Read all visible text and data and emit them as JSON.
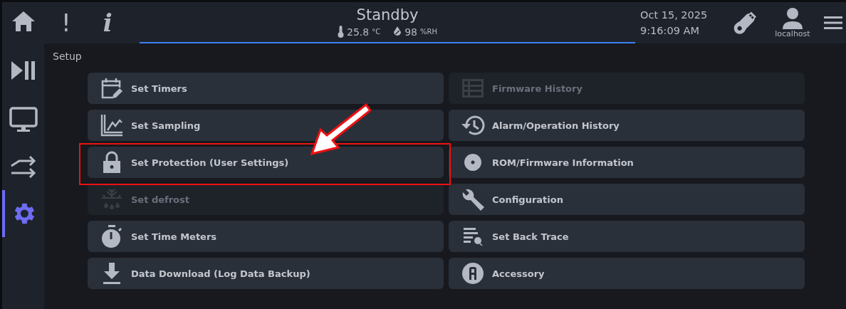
{
  "header": {
    "status": "Standby",
    "temperature": "25.8",
    "temperature_unit": "°C",
    "humidity": "98",
    "humidity_unit": "%RH",
    "date": "Oct 15, 2025",
    "time": "9:16:09 AM",
    "user": "localhost",
    "alert_label": "!",
    "info_label": "i"
  },
  "sidebar": {
    "items": [
      {
        "kind": "run",
        "selected": false
      },
      {
        "kind": "monitor",
        "selected": false
      },
      {
        "kind": "transfer",
        "selected": false
      },
      {
        "kind": "setup",
        "selected": true
      }
    ]
  },
  "page_title": "Setup",
  "menu": {
    "columns": [
      [
        {
          "label": "Set Timers",
          "disabled": false,
          "highlighted": false
        },
        {
          "label": "Set Sampling",
          "disabled": false,
          "highlighted": false
        },
        {
          "label": "Set Protection (User Settings)",
          "disabled": false,
          "highlighted": true
        },
        {
          "label": "Set defrost",
          "disabled": true,
          "highlighted": false
        },
        {
          "label": "Set Time Meters",
          "disabled": false,
          "highlighted": false
        },
        {
          "label": "Data Download (Log Data Backup)",
          "disabled": false,
          "highlighted": false
        }
      ],
      [
        {
          "label": "Firmware History",
          "disabled": true,
          "highlighted": false
        },
        {
          "label": "Alarm/Operation History",
          "disabled": false,
          "highlighted": false
        },
        {
          "label": "ROM/Firmware Information",
          "disabled": false,
          "highlighted": false
        },
        {
          "label": "Configuration",
          "disabled": false,
          "highlighted": false
        },
        {
          "label": "Set Back Trace",
          "disabled": false,
          "highlighted": false
        },
        {
          "label": "Accessory",
          "disabled": false,
          "highlighted": false
        }
      ]
    ]
  }
}
